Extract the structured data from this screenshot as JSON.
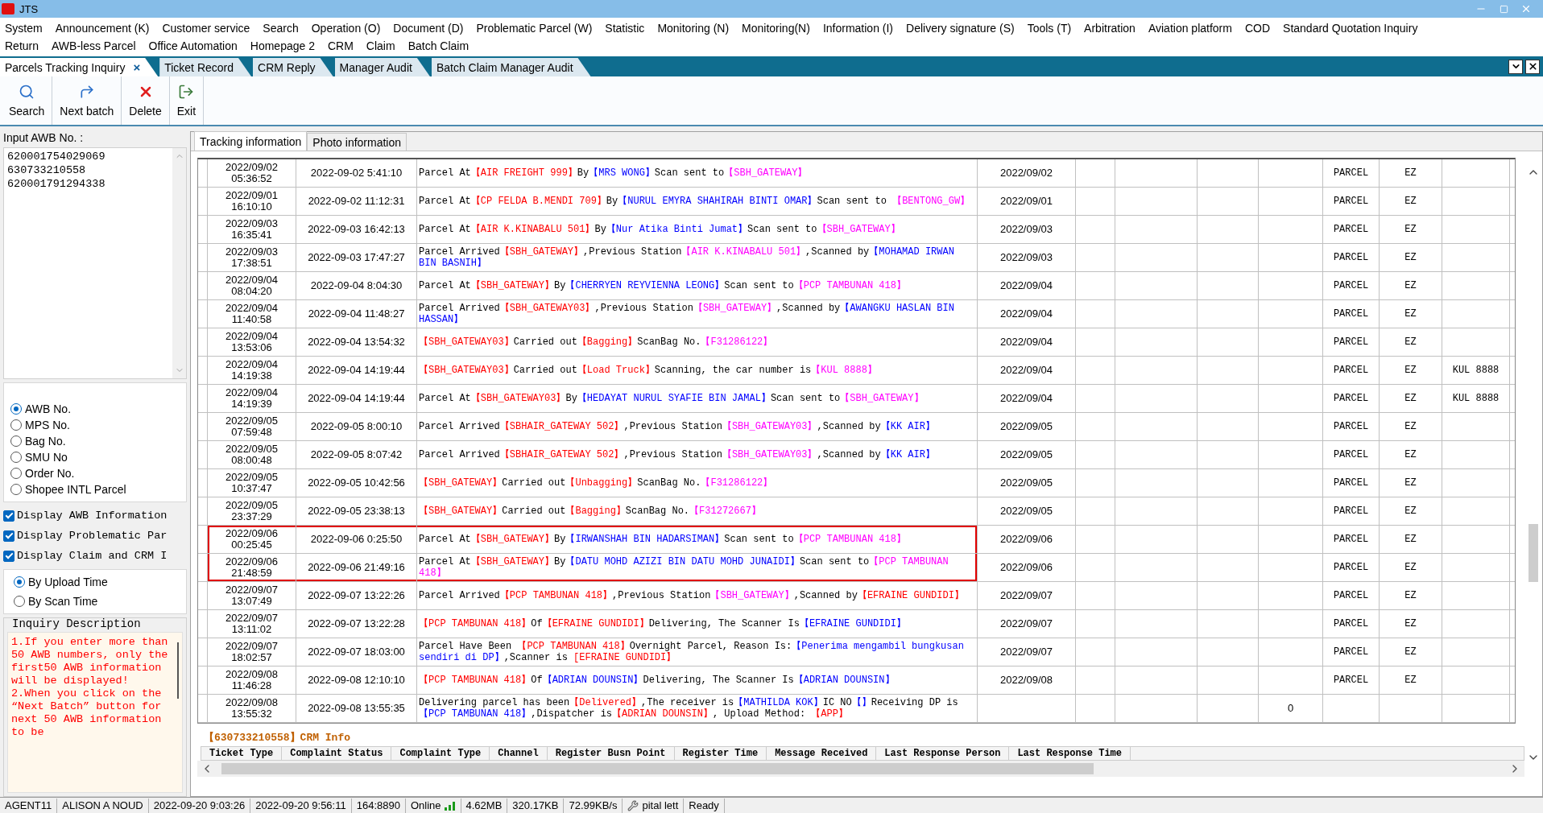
{
  "window": {
    "title": "JTS"
  },
  "menu_rows": [
    [
      "System",
      "Announcement (K)",
      "Customer service",
      "Search",
      "Operation (O)",
      "Document (D)",
      "Problematic Parcel (W)",
      "Statistic",
      "Monitoring (N)",
      "Monitoring(N)",
      "Information (I)",
      "Delivery signature (S)",
      "Tools (T)",
      "Arbitration",
      "Aviation platform",
      "COD",
      "Standard Quotation Inquiry"
    ],
    [
      "Return",
      "AWB-less Parcel",
      "Office Automation",
      "Homepage 2",
      "CRM",
      "Claim",
      "Batch Claim"
    ]
  ],
  "doc_tabs": [
    {
      "label": "Parcels Tracking Inquiry",
      "selected": true,
      "close": "×"
    },
    {
      "label": "Ticket Record",
      "selected": false
    },
    {
      "label": "CRM Reply",
      "selected": false
    },
    {
      "label": "Manager Audit",
      "selected": false
    },
    {
      "label": "Batch Claim Manager Audit",
      "selected": false
    }
  ],
  "toolbar": [
    {
      "kind": "search",
      "label": "Search"
    },
    {
      "kind": "next",
      "label": "Next batch"
    },
    {
      "kind": "delete",
      "label": "Delete"
    },
    {
      "kind": "exit",
      "label": "Exit"
    }
  ],
  "sidebar": {
    "input_label": "Input AWB No. :",
    "awb_numbers": [
      "620001754029069",
      "630733210558",
      "620001791294338"
    ],
    "search_by": [
      {
        "label": "AWB No.",
        "selected": true
      },
      {
        "label": "MPS No.",
        "selected": false
      },
      {
        "label": "Bag No.",
        "selected": false
      },
      {
        "label": "SMU No",
        "selected": false
      },
      {
        "label": "Order No.",
        "selected": false
      },
      {
        "label": "Shopee INTL Parcel",
        "selected": false
      }
    ],
    "options": [
      {
        "label": "Display AWB Information",
        "checked": true
      },
      {
        "label": "Display Problematic Par",
        "checked": true
      },
      {
        "label": "Display Claim and CRM I",
        "checked": true
      }
    ],
    "sort_by": [
      {
        "label": "By Upload Time",
        "selected": true
      },
      {
        "label": "By Scan Time",
        "selected": false
      }
    ],
    "description_title": "Inquiry Description",
    "description": [
      "1.If you enter more than  50  AWB numbers, only the first50  AWB information will be displayed!",
      "2.When you click on the “Next Batch” button for next  50 AWB information to be"
    ]
  },
  "sub_tabs": [
    {
      "label": "Tracking information",
      "selected": true
    },
    {
      "label": "Photo information",
      "selected": false
    }
  ],
  "table": {
    "rows": [
      {
        "column_1": "2022/09/02 05:36:52",
        "column_2": "2022-09-02 5:41:10",
        "column_3": [
          {
            "text": "Parcel At",
            "color": "#000000"
          },
          {
            "text": "【AIR FREIGHT 999】",
            "color": "#ff0000"
          },
          {
            "text": "By",
            "color": "#000000"
          },
          {
            "text": "【MRS WONG】",
            "color": "#0000ff"
          },
          {
            "text": "Scan sent to",
            "color": "#000000"
          },
          {
            "text": "【SBH_GATEWAY】",
            "color": "#ff00ff"
          }
        ],
        "column_4": "2022/09/02",
        "column_9": "PARCEL",
        "column_10": "EZ",
        "outlined": false
      },
      {
        "column_1": "2022/09/01 16:10:10",
        "column_2": "2022-09-02 11:12:31",
        "column_3": [
          {
            "text": "Parcel At",
            "color": "#000000"
          },
          {
            "text": "【CP FELDA B.MENDI 709】",
            "color": "#ff0000"
          },
          {
            "text": "By",
            "color": "#000000"
          },
          {
            "text": "【NURUL EMYRA SHAHIRAH BINTI OMAR】",
            "color": "#0000ff"
          },
          {
            "text": "Scan sent to ",
            "color": "#000000"
          },
          {
            "text": "【BENTONG_GW】",
            "color": "#ff00ff"
          }
        ],
        "column_4": "2022/09/01",
        "column_9": "PARCEL",
        "column_10": "EZ",
        "outlined": false
      },
      {
        "column_1": "2022/09/03 16:35:41",
        "column_2": "2022-09-03 16:42:13",
        "column_3": [
          {
            "text": "Parcel At",
            "color": "#000000"
          },
          {
            "text": "【AIR K.KINABALU 501】",
            "color": "#ff0000"
          },
          {
            "text": "By",
            "color": "#000000"
          },
          {
            "text": "【Nur Atika Binti Jumat】",
            "color": "#0000ff"
          },
          {
            "text": "Scan sent to",
            "color": "#000000"
          },
          {
            "text": "【SBH_GATEWAY】",
            "color": "#ff00ff"
          }
        ],
        "column_4": "2022/09/03",
        "column_9": "PARCEL",
        "column_10": "EZ",
        "outlined": false
      },
      {
        "column_1": "2022/09/03 17:38:51",
        "column_2": "2022-09-03 17:47:27",
        "column_3": [
          {
            "text": "Parcel Arrived",
            "color": "#000000"
          },
          {
            "text": "【SBH_GATEWAY】",
            "color": "#ff0000"
          },
          {
            "text": ",Previous Station",
            "color": "#000000"
          },
          {
            "text": "【AIR K.KINABALU 501】",
            "color": "#ff00ff"
          },
          {
            "text": ",Scanned by",
            "color": "#000000"
          },
          {
            "text": "【MOHAMAD IRWAN BIN BASNIH】",
            "color": "#0000ff"
          }
        ],
        "column_4": "2022/09/03",
        "column_9": "PARCEL",
        "column_10": "EZ",
        "outlined": false
      },
      {
        "column_1": "2022/09/04 08:04:20",
        "column_2": "2022-09-04 8:04:30",
        "column_3": [
          {
            "text": "Parcel At",
            "color": "#000000"
          },
          {
            "text": "【SBH_GATEWAY】",
            "color": "#ff0000"
          },
          {
            "text": "By",
            "color": "#000000"
          },
          {
            "text": "【CHERRYEN REYVIENNA LEONG】",
            "color": "#0000ff"
          },
          {
            "text": "Scan sent to",
            "color": "#000000"
          },
          {
            "text": "【PCP TAMBUNAN 418】",
            "color": "#ff00ff"
          }
        ],
        "column_4": "2022/09/04",
        "column_9": "PARCEL",
        "column_10": "EZ",
        "outlined": false
      },
      {
        "column_1": "2022/09/04 11:40:58",
        "column_2": "2022-09-04 11:48:27",
        "column_3": [
          {
            "text": "Parcel Arrived",
            "color": "#000000"
          },
          {
            "text": "【SBH_GATEWAY03】",
            "color": "#ff0000"
          },
          {
            "text": ",Previous Station",
            "color": "#000000"
          },
          {
            "text": "【SBH_GATEWAY】",
            "color": "#ff00ff"
          },
          {
            "text": ",Scanned by",
            "color": "#000000"
          },
          {
            "text": "【AWANGKU HASLAN BIN HASSAN】",
            "color": "#0000ff"
          }
        ],
        "column_4": "2022/09/04",
        "column_9": "PARCEL",
        "column_10": "EZ",
        "outlined": false
      },
      {
        "column_1": "2022/09/04 13:53:06",
        "column_2": "2022-09-04 13:54:32",
        "column_3": [
          {
            "text": "【SBH_GATEWAY03】",
            "color": "#ff0000"
          },
          {
            "text": "Carried out",
            "color": "#000000"
          },
          {
            "text": "【Bagging】",
            "color": "#ff0000"
          },
          {
            "text": "ScanBag No.",
            "color": "#000000"
          },
          {
            "text": "【F31286122】",
            "color": "#ff00ff"
          }
        ],
        "column_4": "2022/09/04",
        "column_9": "PARCEL",
        "column_10": "EZ",
        "outlined": false
      },
      {
        "column_1": "2022/09/04 14:19:38",
        "column_2": "2022-09-04 14:19:44",
        "column_3": [
          {
            "text": "【SBH_GATEWAY03】",
            "color": "#ff0000"
          },
          {
            "text": "Carried out",
            "color": "#000000"
          },
          {
            "text": "【Load Truck】",
            "color": "#ff0000"
          },
          {
            "text": "Scanning, the car number is",
            "color": "#000000"
          },
          {
            "text": "【KUL 8888】",
            "color": "#ff00ff"
          }
        ],
        "column_4": "2022/09/04",
        "column_9": "PARCEL",
        "column_10": "EZ",
        "column_11": "KUL 8888",
        "outlined": false
      },
      {
        "column_1": "2022/09/04 14:19:39",
        "column_2": "2022-09-04 14:19:44",
        "column_3": [
          {
            "text": "Parcel At",
            "color": "#000000"
          },
          {
            "text": "【SBH_GATEWAY03】",
            "color": "#ff0000"
          },
          {
            "text": "By",
            "color": "#000000"
          },
          {
            "text": "【HEDAYAT NURUL SYAFIE BIN JAMAL】",
            "color": "#0000ff"
          },
          {
            "text": "Scan sent to",
            "color": "#000000"
          },
          {
            "text": "【SBH_GATEWAY】",
            "color": "#ff00ff"
          }
        ],
        "column_4": "2022/09/04",
        "column_9": "PARCEL",
        "column_10": "EZ",
        "column_11": "KUL 8888",
        "outlined": false
      },
      {
        "column_1": "2022/09/05 07:59:48",
        "column_2": "2022-09-05 8:00:10",
        "column_3": [
          {
            "text": "Parcel Arrived",
            "color": "#000000"
          },
          {
            "text": "【SBHAIR_GATEWAY 502】",
            "color": "#ff0000"
          },
          {
            "text": ",Previous Station",
            "color": "#000000"
          },
          {
            "text": "【SBH_GATEWAY03】",
            "color": "#ff00ff"
          },
          {
            "text": ",Scanned by",
            "color": "#000000"
          },
          {
            "text": "【KK AIR】",
            "color": "#0000ff"
          }
        ],
        "column_4": "2022/09/05",
        "column_9": "PARCEL",
        "column_10": "EZ",
        "outlined": false
      },
      {
        "column_1": "2022/09/05 08:00:48",
        "column_2": "2022-09-05 8:07:42",
        "column_3": [
          {
            "text": "Parcel Arrived",
            "color": "#000000"
          },
          {
            "text": "【SBHAIR_GATEWAY 502】",
            "color": "#ff0000"
          },
          {
            "text": ",Previous Station",
            "color": "#000000"
          },
          {
            "text": "【SBH_GATEWAY03】",
            "color": "#ff00ff"
          },
          {
            "text": ",Scanned by",
            "color": "#000000"
          },
          {
            "text": "【KK AIR】",
            "color": "#0000ff"
          }
        ],
        "column_4": "2022/09/05",
        "column_9": "PARCEL",
        "column_10": "EZ",
        "outlined": false
      },
      {
        "column_1": "2022/09/05 10:37:47",
        "column_2": "2022-09-05 10:42:56",
        "column_3": [
          {
            "text": "【SBH_GATEWAY】",
            "color": "#ff0000"
          },
          {
            "text": "Carried out",
            "color": "#000000"
          },
          {
            "text": "【Unbagging】",
            "color": "#ff0000"
          },
          {
            "text": "ScanBag No.",
            "color": "#000000"
          },
          {
            "text": "【F31286122】",
            "color": "#ff00ff"
          }
        ],
        "column_4": "2022/09/05",
        "column_9": "PARCEL",
        "column_10": "EZ",
        "outlined": false
      },
      {
        "column_1": "2022/09/05 23:37:29",
        "column_2": "2022-09-05 23:38:13",
        "column_3": [
          {
            "text": "【SBH_GATEWAY】",
            "color": "#ff0000"
          },
          {
            "text": "Carried out",
            "color": "#000000"
          },
          {
            "text": "【Bagging】",
            "color": "#ff0000"
          },
          {
            "text": "ScanBag No.",
            "color": "#000000"
          },
          {
            "text": "【F31272667】",
            "color": "#ff00ff"
          }
        ],
        "column_4": "2022/09/05",
        "column_9": "PARCEL",
        "column_10": "EZ",
        "outlined": false
      },
      {
        "column_1": "2022/09/06 00:25:45",
        "column_2": "2022-09-06 0:25:50",
        "column_3": [
          {
            "text": "Parcel At",
            "color": "#000000"
          },
          {
            "text": "【SBH_GATEWAY】",
            "color": "#ff0000"
          },
          {
            "text": "By",
            "color": "#000000"
          },
          {
            "text": "【IRWANSHAH BIN HADARSIMAN】",
            "color": "#0000ff"
          },
          {
            "text": "Scan sent to",
            "color": "#000000"
          },
          {
            "text": "【PCP TAMBUNAN 418】",
            "color": "#ff00ff"
          }
        ],
        "column_4": "2022/09/06",
        "column_9": "PARCEL",
        "column_10": "EZ",
        "outlined": true
      },
      {
        "column_1": "2022/09/06 21:48:59",
        "column_2": "2022-09-06 21:49:16",
        "column_3": [
          {
            "text": "Parcel At",
            "color": "#000000"
          },
          {
            "text": "【SBH_GATEWAY】",
            "color": "#ff0000"
          },
          {
            "text": "By",
            "color": "#000000"
          },
          {
            "text": "【DATU MOHD AZIZI BIN DATU MOHD JUNAIDI】",
            "color": "#0000ff"
          },
          {
            "text": "Scan sent to",
            "color": "#000000"
          },
          {
            "text": "【PCP TAMBUNAN 418】",
            "color": "#ff00ff"
          }
        ],
        "column_4": "2022/09/06",
        "column_9": "PARCEL",
        "column_10": "EZ",
        "outlined": true
      },
      {
        "column_1": "2022/09/07 13:07:49",
        "column_2": "2022-09-07 13:22:26",
        "column_3": [
          {
            "text": "Parcel Arrived",
            "color": "#000000"
          },
          {
            "text": "【PCP TAMBUNAN 418】",
            "color": "#ff0000"
          },
          {
            "text": ",Previous Station",
            "color": "#000000"
          },
          {
            "text": "【SBH_GATEWAY】",
            "color": "#ff00ff"
          },
          {
            "text": ",Scanned by",
            "color": "#000000"
          },
          {
            "text": "【EFRAINE GUNDIDI】",
            "color": "#ff0000"
          }
        ],
        "column_4": "2022/09/07",
        "column_9": "PARCEL",
        "column_10": "EZ",
        "outlined": false
      },
      {
        "column_1": "2022/09/07 13:11:02",
        "column_2": "2022-09-07 13:22:28",
        "column_3": [
          {
            "text": "【PCP TAMBUNAN 418】",
            "color": "#ff0000"
          },
          {
            "text": "Of",
            "color": "#000000"
          },
          {
            "text": "【EFRAINE GUNDIDI】",
            "color": "#ff0000"
          },
          {
            "text": "Delivering, The Scanner Is",
            "color": "#000000"
          },
          {
            "text": "【EFRAINE GUNDIDI】",
            "color": "#0000ff"
          }
        ],
        "column_4": "2022/09/07",
        "column_9": "PARCEL",
        "column_10": "EZ",
        "outlined": false
      },
      {
        "column_1": "2022/09/07 18:02:57",
        "column_2": "2022-09-07 18:03:00",
        "column_3": [
          {
            "text": "Parcel Have Been ",
            "color": "#000000"
          },
          {
            "text": "【PCP TAMBUNAN 418】",
            "color": "#ff0000"
          },
          {
            "text": "Overnight Parcel, Reason Is:",
            "color": "#000000"
          },
          {
            "text": "【Penerima mengambil bungkusan sendiri di DP】",
            "color": "#0000ff"
          },
          {
            "text": ",Scanner is ",
            "color": "#000000"
          },
          {
            "text": "[EFRAINE GUNDIDI】",
            "color": "#ff0000"
          }
        ],
        "column_4": "2022/09/07",
        "column_9": "PARCEL",
        "column_10": "EZ",
        "outlined": false
      },
      {
        "column_1": "2022/09/08 11:46:28",
        "column_2": "2022-09-08 12:10:10",
        "column_3": [
          {
            "text": "【PCP TAMBUNAN 418】",
            "color": "#ff0000"
          },
          {
            "text": "Of",
            "color": "#000000"
          },
          {
            "text": "【ADRIAN DOUNSIN】",
            "color": "#0000ff"
          },
          {
            "text": "Delivering, The Scanner Is",
            "color": "#000000"
          },
          {
            "text": "【ADRIAN DOUNSIN】",
            "color": "#0000ff"
          }
        ],
        "column_4": "2022/09/08",
        "column_9": "PARCEL",
        "column_10": "EZ",
        "outlined": false
      },
      {
        "column_1": "2022/09/08 13:55:32",
        "column_2": "2022-09-08 13:55:35",
        "column_3": [
          {
            "text": "Delivering parcel has been",
            "color": "#000000"
          },
          {
            "text": "【Delivered】",
            "color": "#ff0000"
          },
          {
            "text": ",The receiver is",
            "color": "#000000"
          },
          {
            "text": "【MATHILDA KOK】",
            "color": "#0000ff"
          },
          {
            "text": "IC NO",
            "color": "#000000"
          },
          {
            "text": "【】",
            "color": "#0000ff"
          },
          {
            "text": "Receiving DP is",
            "color": "#000000"
          },
          {
            "text": "【PCP TAMBUNAN 418】",
            "color": "#0000ff"
          },
          {
            "text": ",Dispatcher is",
            "color": "#000000"
          },
          {
            "text": "【ADRIAN DOUNSIN】",
            "color": "#ff0000"
          },
          {
            "text": ", Upload Method: ",
            "color": "#000000"
          },
          {
            "text": "【APP】",
            "color": "#ff0000"
          }
        ],
        "column_8": "0",
        "outlined": false
      }
    ]
  },
  "crm": {
    "title": "【630733210558】CRM Info",
    "columns": [
      "Ticket Type",
      "Complaint Status",
      "Complaint Type",
      "Channel",
      "Register Busn Point",
      "Register Time",
      "Message Received",
      "Last Response Person",
      "Last Response Time"
    ]
  },
  "status_bar": [
    {
      "kind": "text",
      "text": "AGENT11"
    },
    {
      "kind": "text",
      "text": "ALISON A NOUD"
    },
    {
      "kind": "text",
      "text": "2022-09-20 9:03:26"
    },
    {
      "kind": "text",
      "text": "2022-09-20 9:56:11"
    },
    {
      "kind": "text",
      "text": "164:8890"
    },
    {
      "kind": "online",
      "text": "Online"
    },
    {
      "kind": "text",
      "text": "4.62MB"
    },
    {
      "kind": "text",
      "text": "320.17KB"
    },
    {
      "kind": "text",
      "text": "72.99KB/s"
    },
    {
      "kind": "tool",
      "text": "pital lett"
    },
    {
      "kind": "text",
      "text": "Ready"
    }
  ]
}
